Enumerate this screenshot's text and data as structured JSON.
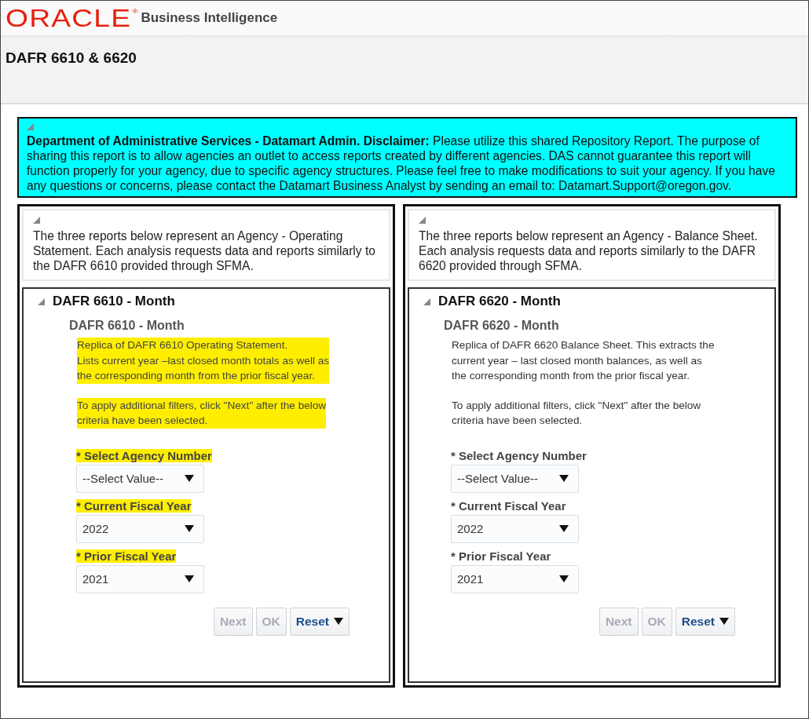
{
  "header": {
    "logo": "ORACLE",
    "logo_mark": "®",
    "product": "Business Intelligence"
  },
  "page_title": "DAFR 6610 & 6620",
  "disclaimer": {
    "expanded": true,
    "text": "**Department of Administrative Services - Datamart Admin. Disclaimer:** Please utilize this shared Repository Report. The purpose of sharing this report is to allow agencies an outlet to access reports created by different agencies. DAS cannot guarantee this report will function properly for your agency, due to specific agency structures. Please feel free to make modifications to suit your agency. If you have any questions or concerns, please contact the Datamart Business Analyst by sending an email to: Datamart.Support@oregon.gov."
  },
  "panels": [
    {
      "intro": "The three reports below represent an Agency - Operating Statement. Each analysis requests data and reports similarly to the DAFR 6610 provided through SFMA.",
      "section_title": "DAFR 6610 - Month",
      "expanded": true,
      "report_title": "DAFR 6610 - Month",
      "highlighted": true,
      "description": "Replica of DAFR 6610 Operating Statement.\nLists current year –last closed month totals as well as\nthe corresponding month from the prior fiscal year.",
      "instructions": "To apply additional filters, click \"Next\" after the below\ncriteria have been selected.",
      "prompts": [
        {
          "mark": "*",
          "label": "Select Agency Number",
          "value": "--Select Value--"
        },
        {
          "mark": "*",
          "label": "Current Fiscal Year",
          "value": "2022"
        },
        {
          "mark": "*",
          "label": "Prior Fiscal Year",
          "value": "2021"
        }
      ],
      "buttons": [
        {
          "label": "Next",
          "disabled": true,
          "menu": false
        },
        {
          "label": "OK",
          "disabled": true,
          "menu": false
        },
        {
          "label": "Reset",
          "disabled": false,
          "menu": true
        }
      ]
    },
    {
      "intro": "The three reports below represent an Agency - Balance Sheet. Each analysis requests data and reports similarly to the DAFR 6620 provided through SFMA.",
      "section_title": "DAFR 6620 - Month",
      "expanded": true,
      "report_title": "DAFR 6620 - Month",
      "highlighted": false,
      "description": "Replica of DAFR 6620 Balance Sheet. This extracts the\ncurrent year – last closed month balances, as well as\nthe corresponding month from the prior fiscal year.",
      "instructions": "To apply additional filters, click \"Next\" after the below\ncriteria have been selected.",
      "prompts": [
        {
          "mark": "*",
          "label": "Select Agency Number",
          "value": "--Select Value--"
        },
        {
          "mark": "*",
          "label": "Current Fiscal Year",
          "value": "2022"
        },
        {
          "mark": "*",
          "label": "Prior Fiscal Year",
          "value": "2021"
        }
      ],
      "buttons": [
        {
          "label": "Next",
          "disabled": true,
          "menu": false
        },
        {
          "label": "OK",
          "disabled": true,
          "menu": false
        },
        {
          "label": "Reset",
          "disabled": false,
          "menu": true
        }
      ]
    }
  ]
}
